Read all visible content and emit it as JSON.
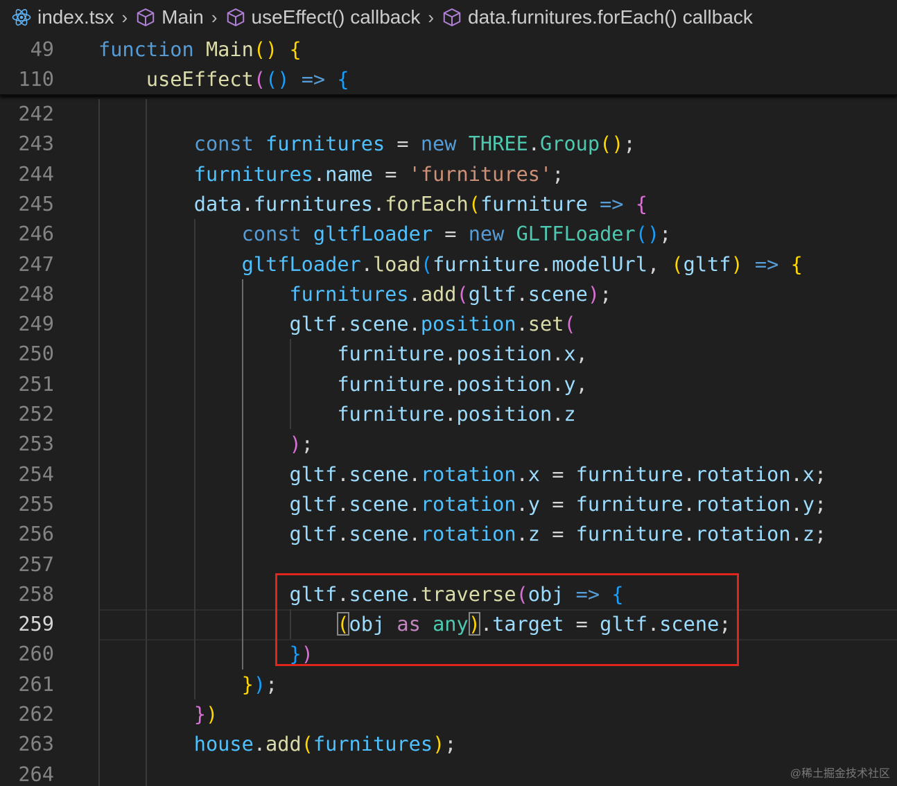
{
  "breadcrumb": [
    {
      "label": "index.tsx",
      "icon": "react-icon"
    },
    {
      "label": "Main",
      "icon": "cube-icon"
    },
    {
      "label": "useEffect() callback",
      "icon": "cube-icon"
    },
    {
      "label": "data.furnitures.forEach() callback",
      "icon": "cube-icon"
    }
  ],
  "sticky_lines": [
    {
      "num": "49",
      "tokens": [
        [
          "k",
          "function"
        ],
        [
          "t",
          " "
        ],
        [
          "fn",
          "Main"
        ],
        [
          "b1",
          "()"
        ],
        [
          "t",
          " "
        ],
        [
          "b1",
          "{"
        ]
      ]
    },
    {
      "num": "110",
      "tokens": [
        [
          "t",
          "    "
        ],
        [
          "fn",
          "useEffect"
        ],
        [
          "b2",
          "("
        ],
        [
          "b3",
          "()"
        ],
        [
          "t",
          " "
        ],
        [
          "k",
          "=>"
        ],
        [
          "t",
          " "
        ],
        [
          "b3",
          "{"
        ]
      ]
    }
  ],
  "lines": [
    {
      "num": "242",
      "tokens": []
    },
    {
      "num": "243",
      "tokens": [
        [
          "t",
          "        "
        ],
        [
          "k",
          "const"
        ],
        [
          "t",
          " "
        ],
        [
          "p",
          "furnitures"
        ],
        [
          "t",
          " = "
        ],
        [
          "k",
          "new"
        ],
        [
          "t",
          " "
        ],
        [
          "c",
          "THREE"
        ],
        [
          "t",
          "."
        ],
        [
          "c",
          "Group"
        ],
        [
          "b1",
          "()"
        ],
        [
          "t",
          ";"
        ]
      ]
    },
    {
      "num": "244",
      "tokens": [
        [
          "t",
          "        "
        ],
        [
          "p",
          "furnitures"
        ],
        [
          "t",
          "."
        ],
        [
          "v",
          "name"
        ],
        [
          "t",
          " = "
        ],
        [
          "s",
          "'furnitures'"
        ],
        [
          "t",
          ";"
        ]
      ]
    },
    {
      "num": "245",
      "tokens": [
        [
          "t",
          "        "
        ],
        [
          "v",
          "data"
        ],
        [
          "t",
          "."
        ],
        [
          "v",
          "furnitures"
        ],
        [
          "t",
          "."
        ],
        [
          "fn",
          "forEach"
        ],
        [
          "b1",
          "("
        ],
        [
          "v",
          "furniture"
        ],
        [
          "t",
          " "
        ],
        [
          "k",
          "=>"
        ],
        [
          "t",
          " "
        ],
        [
          "b2",
          "{"
        ]
      ]
    },
    {
      "num": "246",
      "tokens": [
        [
          "t",
          "            "
        ],
        [
          "k",
          "const"
        ],
        [
          "t",
          " "
        ],
        [
          "p",
          "gltfLoader"
        ],
        [
          "t",
          " = "
        ],
        [
          "k",
          "new"
        ],
        [
          "t",
          " "
        ],
        [
          "c",
          "GLTFLoader"
        ],
        [
          "b3",
          "()"
        ],
        [
          "t",
          ";"
        ]
      ]
    },
    {
      "num": "247",
      "tokens": [
        [
          "t",
          "            "
        ],
        [
          "p",
          "gltfLoader"
        ],
        [
          "t",
          "."
        ],
        [
          "fn",
          "load"
        ],
        [
          "b3",
          "("
        ],
        [
          "v",
          "furniture"
        ],
        [
          "t",
          "."
        ],
        [
          "v",
          "modelUrl"
        ],
        [
          "t",
          ", "
        ],
        [
          "b1",
          "("
        ],
        [
          "v",
          "gltf"
        ],
        [
          "b1",
          ")"
        ],
        [
          "t",
          " "
        ],
        [
          "k",
          "=>"
        ],
        [
          "t",
          " "
        ],
        [
          "b1",
          "{"
        ]
      ]
    },
    {
      "num": "248",
      "tokens": [
        [
          "t",
          "                "
        ],
        [
          "p",
          "furnitures"
        ],
        [
          "t",
          "."
        ],
        [
          "fn",
          "add"
        ],
        [
          "b2",
          "("
        ],
        [
          "v",
          "gltf"
        ],
        [
          "t",
          "."
        ],
        [
          "v",
          "scene"
        ],
        [
          "b2",
          ")"
        ],
        [
          "t",
          ";"
        ]
      ]
    },
    {
      "num": "249",
      "tokens": [
        [
          "t",
          "                "
        ],
        [
          "v",
          "gltf"
        ],
        [
          "t",
          "."
        ],
        [
          "v",
          "scene"
        ],
        [
          "t",
          "."
        ],
        [
          "p",
          "position"
        ],
        [
          "t",
          "."
        ],
        [
          "fn",
          "set"
        ],
        [
          "b2",
          "("
        ]
      ]
    },
    {
      "num": "250",
      "tokens": [
        [
          "t",
          "                    "
        ],
        [
          "v",
          "furniture"
        ],
        [
          "t",
          "."
        ],
        [
          "v",
          "position"
        ],
        [
          "t",
          "."
        ],
        [
          "v",
          "x"
        ],
        [
          "t",
          ","
        ]
      ]
    },
    {
      "num": "251",
      "tokens": [
        [
          "t",
          "                    "
        ],
        [
          "v",
          "furniture"
        ],
        [
          "t",
          "."
        ],
        [
          "v",
          "position"
        ],
        [
          "t",
          "."
        ],
        [
          "v",
          "y"
        ],
        [
          "t",
          ","
        ]
      ]
    },
    {
      "num": "252",
      "tokens": [
        [
          "t",
          "                    "
        ],
        [
          "v",
          "furniture"
        ],
        [
          "t",
          "."
        ],
        [
          "v",
          "position"
        ],
        [
          "t",
          "."
        ],
        [
          "v",
          "z"
        ]
      ]
    },
    {
      "num": "253",
      "tokens": [
        [
          "t",
          "                "
        ],
        [
          "b2",
          ")"
        ],
        [
          "t",
          ";"
        ]
      ]
    },
    {
      "num": "254",
      "tokens": [
        [
          "t",
          "                "
        ],
        [
          "v",
          "gltf"
        ],
        [
          "t",
          "."
        ],
        [
          "v",
          "scene"
        ],
        [
          "t",
          "."
        ],
        [
          "p",
          "rotation"
        ],
        [
          "t",
          "."
        ],
        [
          "v",
          "x"
        ],
        [
          "t",
          " = "
        ],
        [
          "v",
          "furniture"
        ],
        [
          "t",
          "."
        ],
        [
          "v",
          "rotation"
        ],
        [
          "t",
          "."
        ],
        [
          "v",
          "x"
        ],
        [
          "t",
          ";"
        ]
      ]
    },
    {
      "num": "255",
      "tokens": [
        [
          "t",
          "                "
        ],
        [
          "v",
          "gltf"
        ],
        [
          "t",
          "."
        ],
        [
          "v",
          "scene"
        ],
        [
          "t",
          "."
        ],
        [
          "p",
          "rotation"
        ],
        [
          "t",
          "."
        ],
        [
          "v",
          "y"
        ],
        [
          "t",
          " = "
        ],
        [
          "v",
          "furniture"
        ],
        [
          "t",
          "."
        ],
        [
          "v",
          "rotation"
        ],
        [
          "t",
          "."
        ],
        [
          "v",
          "y"
        ],
        [
          "t",
          ";"
        ]
      ]
    },
    {
      "num": "256",
      "tokens": [
        [
          "t",
          "                "
        ],
        [
          "v",
          "gltf"
        ],
        [
          "t",
          "."
        ],
        [
          "v",
          "scene"
        ],
        [
          "t",
          "."
        ],
        [
          "p",
          "rotation"
        ],
        [
          "t",
          "."
        ],
        [
          "v",
          "z"
        ],
        [
          "t",
          " = "
        ],
        [
          "v",
          "furniture"
        ],
        [
          "t",
          "."
        ],
        [
          "v",
          "rotation"
        ],
        [
          "t",
          "."
        ],
        [
          "v",
          "z"
        ],
        [
          "t",
          ";"
        ]
      ]
    },
    {
      "num": "257",
      "tokens": []
    },
    {
      "num": "258",
      "tokens": [
        [
          "t",
          "                "
        ],
        [
          "v",
          "gltf"
        ],
        [
          "t",
          "."
        ],
        [
          "v",
          "scene"
        ],
        [
          "t",
          "."
        ],
        [
          "fn",
          "traverse"
        ],
        [
          "b2",
          "("
        ],
        [
          "v",
          "obj"
        ],
        [
          "t",
          " "
        ],
        [
          "k",
          "=>"
        ],
        [
          "t",
          " "
        ],
        [
          "b3",
          "{"
        ]
      ]
    },
    {
      "num": "259",
      "active": true,
      "tokens": [
        [
          "t",
          "                    "
        ],
        [
          "b1m",
          "("
        ],
        [
          "v",
          "obj"
        ],
        [
          "t",
          " "
        ],
        [
          "kp",
          "as"
        ],
        [
          "t",
          " "
        ],
        [
          "c",
          "any"
        ],
        [
          "b1m",
          ")"
        ],
        [
          "t",
          "."
        ],
        [
          "v",
          "target"
        ],
        [
          "t",
          " = "
        ],
        [
          "v",
          "gltf"
        ],
        [
          "t",
          "."
        ],
        [
          "v",
          "scene"
        ],
        [
          "t",
          ";"
        ]
      ]
    },
    {
      "num": "260",
      "tokens": [
        [
          "t",
          "                "
        ],
        [
          "b3",
          "}"
        ],
        [
          "b2",
          ")"
        ]
      ]
    },
    {
      "num": "261",
      "tokens": [
        [
          "t",
          "            "
        ],
        [
          "b1",
          "}"
        ],
        [
          "b3",
          ")"
        ],
        [
          "t",
          ";"
        ]
      ]
    },
    {
      "num": "262",
      "tokens": [
        [
          "t",
          "        "
        ],
        [
          "b2",
          "}"
        ],
        [
          "b1",
          ")"
        ]
      ]
    },
    {
      "num": "263",
      "tokens": [
        [
          "t",
          "        "
        ],
        [
          "p",
          "house"
        ],
        [
          "t",
          "."
        ],
        [
          "fn",
          "add"
        ],
        [
          "b1",
          "("
        ],
        [
          "p",
          "furnitures"
        ],
        [
          "b1",
          ")"
        ],
        [
          "t",
          ";"
        ]
      ]
    },
    {
      "num": "264",
      "tokens": []
    }
  ],
  "watermark": "@稀土掘金技术社区"
}
